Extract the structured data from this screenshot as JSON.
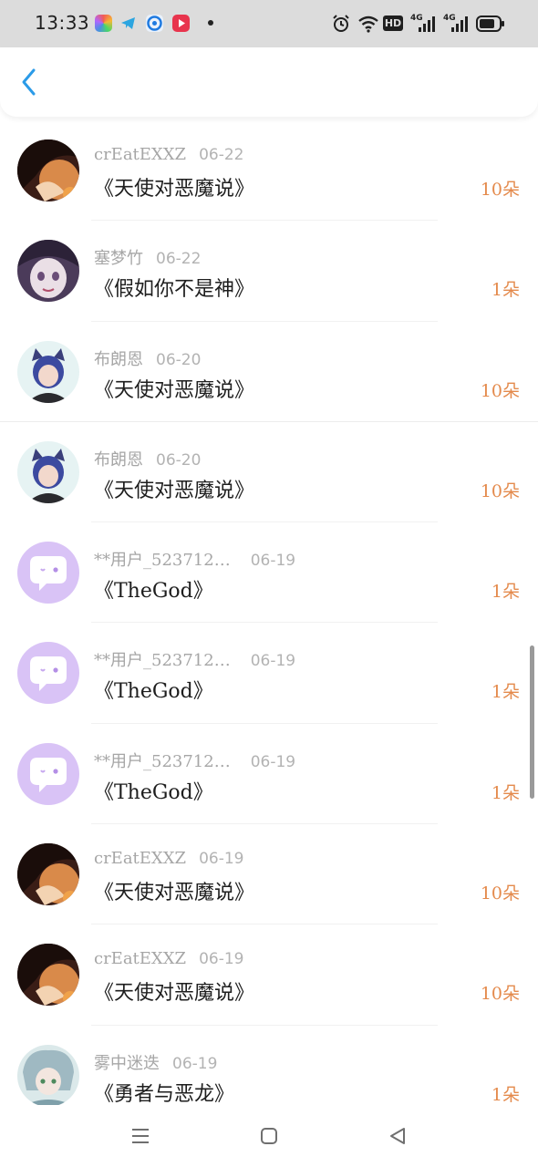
{
  "status_bar": {
    "time": "13:33",
    "notification_icons": [
      "multicolor-app-icon",
      "telegram-icon",
      "blue-circle-app-icon",
      "red-play-app-icon"
    ],
    "system_icons": [
      "alarm-icon",
      "wifi-icon",
      "hd-icon",
      "signal-4g-icon",
      "signal-4g-icon",
      "battery-icon"
    ],
    "hd_label": "HD",
    "network_label": "4G"
  },
  "header": {
    "back_icon": "chevron-left-icon",
    "accent_color": "#2b9be8"
  },
  "list": {
    "items": [
      {
        "user": "crEatEXXZ",
        "date": "06-22",
        "title": "《天使对恶魔说》",
        "count": "10朵",
        "avatar": "dark-hair-anime-avatar"
      },
      {
        "user": "塞梦竹",
        "date": "06-22",
        "title": "《假如你不是神》",
        "count": "1朵",
        "avatar": "sketch-girl-avatar"
      },
      {
        "user": "布朗恩",
        "date": "06-20",
        "title": "《天使对恶魔说》",
        "count": "10朵",
        "avatar": "blue-hair-catgirl-avatar"
      },
      {
        "user": "布朗恩",
        "date": "06-20",
        "title": "《天使对恶魔说》",
        "count": "10朵",
        "avatar": "blue-hair-catgirl-avatar"
      },
      {
        "user": "**用户_523712…",
        "date": "06-19",
        "title": "《TheGod》",
        "count": "1朵",
        "avatar": "default-chat-bubble-avatar"
      },
      {
        "user": "**用户_523712…",
        "date": "06-19",
        "title": "《TheGod》",
        "count": "1朵",
        "avatar": "default-chat-bubble-avatar"
      },
      {
        "user": "**用户_523712…",
        "date": "06-19",
        "title": "《TheGod》",
        "count": "1朵",
        "avatar": "default-chat-bubble-avatar"
      },
      {
        "user": "crEatEXXZ",
        "date": "06-19",
        "title": "《天使对恶魔说》",
        "count": "10朵",
        "avatar": "dark-hair-anime-avatar"
      },
      {
        "user": "crEatEXXZ",
        "date": "06-19",
        "title": "《天使对恶魔说》",
        "count": "10朵",
        "avatar": "dark-hair-anime-avatar"
      },
      {
        "user": "雾中迷迭",
        "date": "06-19",
        "title": "《勇者与恶龙》",
        "count": "1朵",
        "avatar": "silver-hair-anime-avatar"
      }
    ],
    "count_color": "#e48a4c"
  },
  "nav_bar": {
    "icons": [
      "menu-icon",
      "home-square-icon",
      "back-triangle-icon"
    ]
  }
}
